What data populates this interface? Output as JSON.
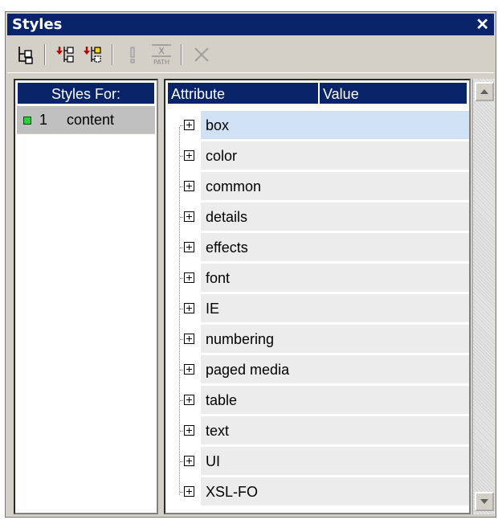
{
  "window": {
    "title": "Styles",
    "close_glyph": "✕"
  },
  "toolbar": {
    "buttons": [
      {
        "name": "tree-view-icon"
      },
      {
        "name": "insert-before-icon"
      },
      {
        "name": "insert-after-icon"
      },
      {
        "name": "important-icon"
      },
      {
        "name": "xpath-icon",
        "top": "X",
        "bottom": "PATH"
      },
      {
        "name": "delete-icon"
      }
    ]
  },
  "styles_for": {
    "header": "Styles For:",
    "items": [
      {
        "number": "1",
        "label": "content",
        "color": "#2ecc40"
      }
    ]
  },
  "attributes": {
    "header_attribute": "Attribute",
    "header_value": "Value",
    "groups": [
      {
        "label": "box",
        "selected": true
      },
      {
        "label": "color"
      },
      {
        "label": "common"
      },
      {
        "label": "details"
      },
      {
        "label": "effects"
      },
      {
        "label": "font"
      },
      {
        "label": "IE"
      },
      {
        "label": "numbering"
      },
      {
        "label": "paged media"
      },
      {
        "label": "table"
      },
      {
        "label": "text"
      },
      {
        "label": "UI"
      },
      {
        "label": "XSL-FO"
      }
    ]
  },
  "colors": {
    "header_bg": "#0a246a",
    "selected_row": "#cfe1f3",
    "row_bg": "#ececec"
  }
}
